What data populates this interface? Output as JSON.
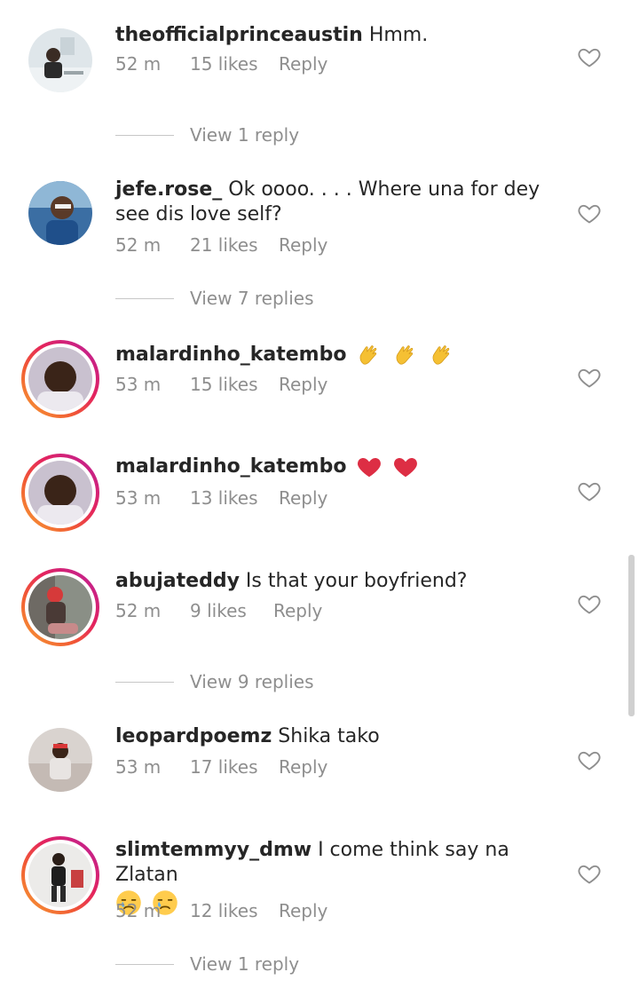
{
  "comments": [
    {
      "username": "theofficialprinceaustin",
      "text": "Hmm.",
      "time": "52 m",
      "likes": "15 likes",
      "reply": "Reply",
      "view_replies": "View 1 reply"
    },
    {
      "username": "jefe.rose_",
      "text": "Ok oooo. . . . Where una for dey see dis love self?",
      "time": "52 m",
      "likes": "21 likes",
      "reply": "Reply",
      "view_replies": "View 7 replies"
    },
    {
      "username": "malardinho_katembo",
      "text": "",
      "emoji": [
        "clapping-hands-emoji",
        "clapping-hands-emoji",
        "clapping-hands-emoji"
      ],
      "time": "53 m",
      "likes": "15 likes",
      "reply": "Reply"
    },
    {
      "username": "malardinho_katembo",
      "text": "",
      "emoji": [
        "red-heart-emoji",
        "red-heart-emoji"
      ],
      "time": "53 m",
      "likes": "13 likes",
      "reply": "Reply"
    },
    {
      "username": "abujateddy",
      "text": "Is that your boyfriend?",
      "time": "52 m",
      "likes": "9 likes",
      "reply": "Reply",
      "view_replies": "View 9 replies"
    },
    {
      "username": "leopardpoemz",
      "text": "Shika tako",
      "time": "53 m",
      "likes": "17 likes",
      "reply": "Reply"
    },
    {
      "username": "slimtemmyy_dmw",
      "text": "I come think say na Zlatan",
      "emoji": [
        "crying-face-emoji",
        "crying-face-emoji"
      ],
      "time": "52 m",
      "likes": "12 likes",
      "reply": "Reply",
      "view_replies": "View 1 reply"
    }
  ],
  "colors": {
    "text": "#262626",
    "meta": "#8e8e8e",
    "story_ring_start": "#f7a234",
    "story_ring_end": "#b8209e"
  },
  "icons": {
    "like": "heart-outline-icon"
  }
}
